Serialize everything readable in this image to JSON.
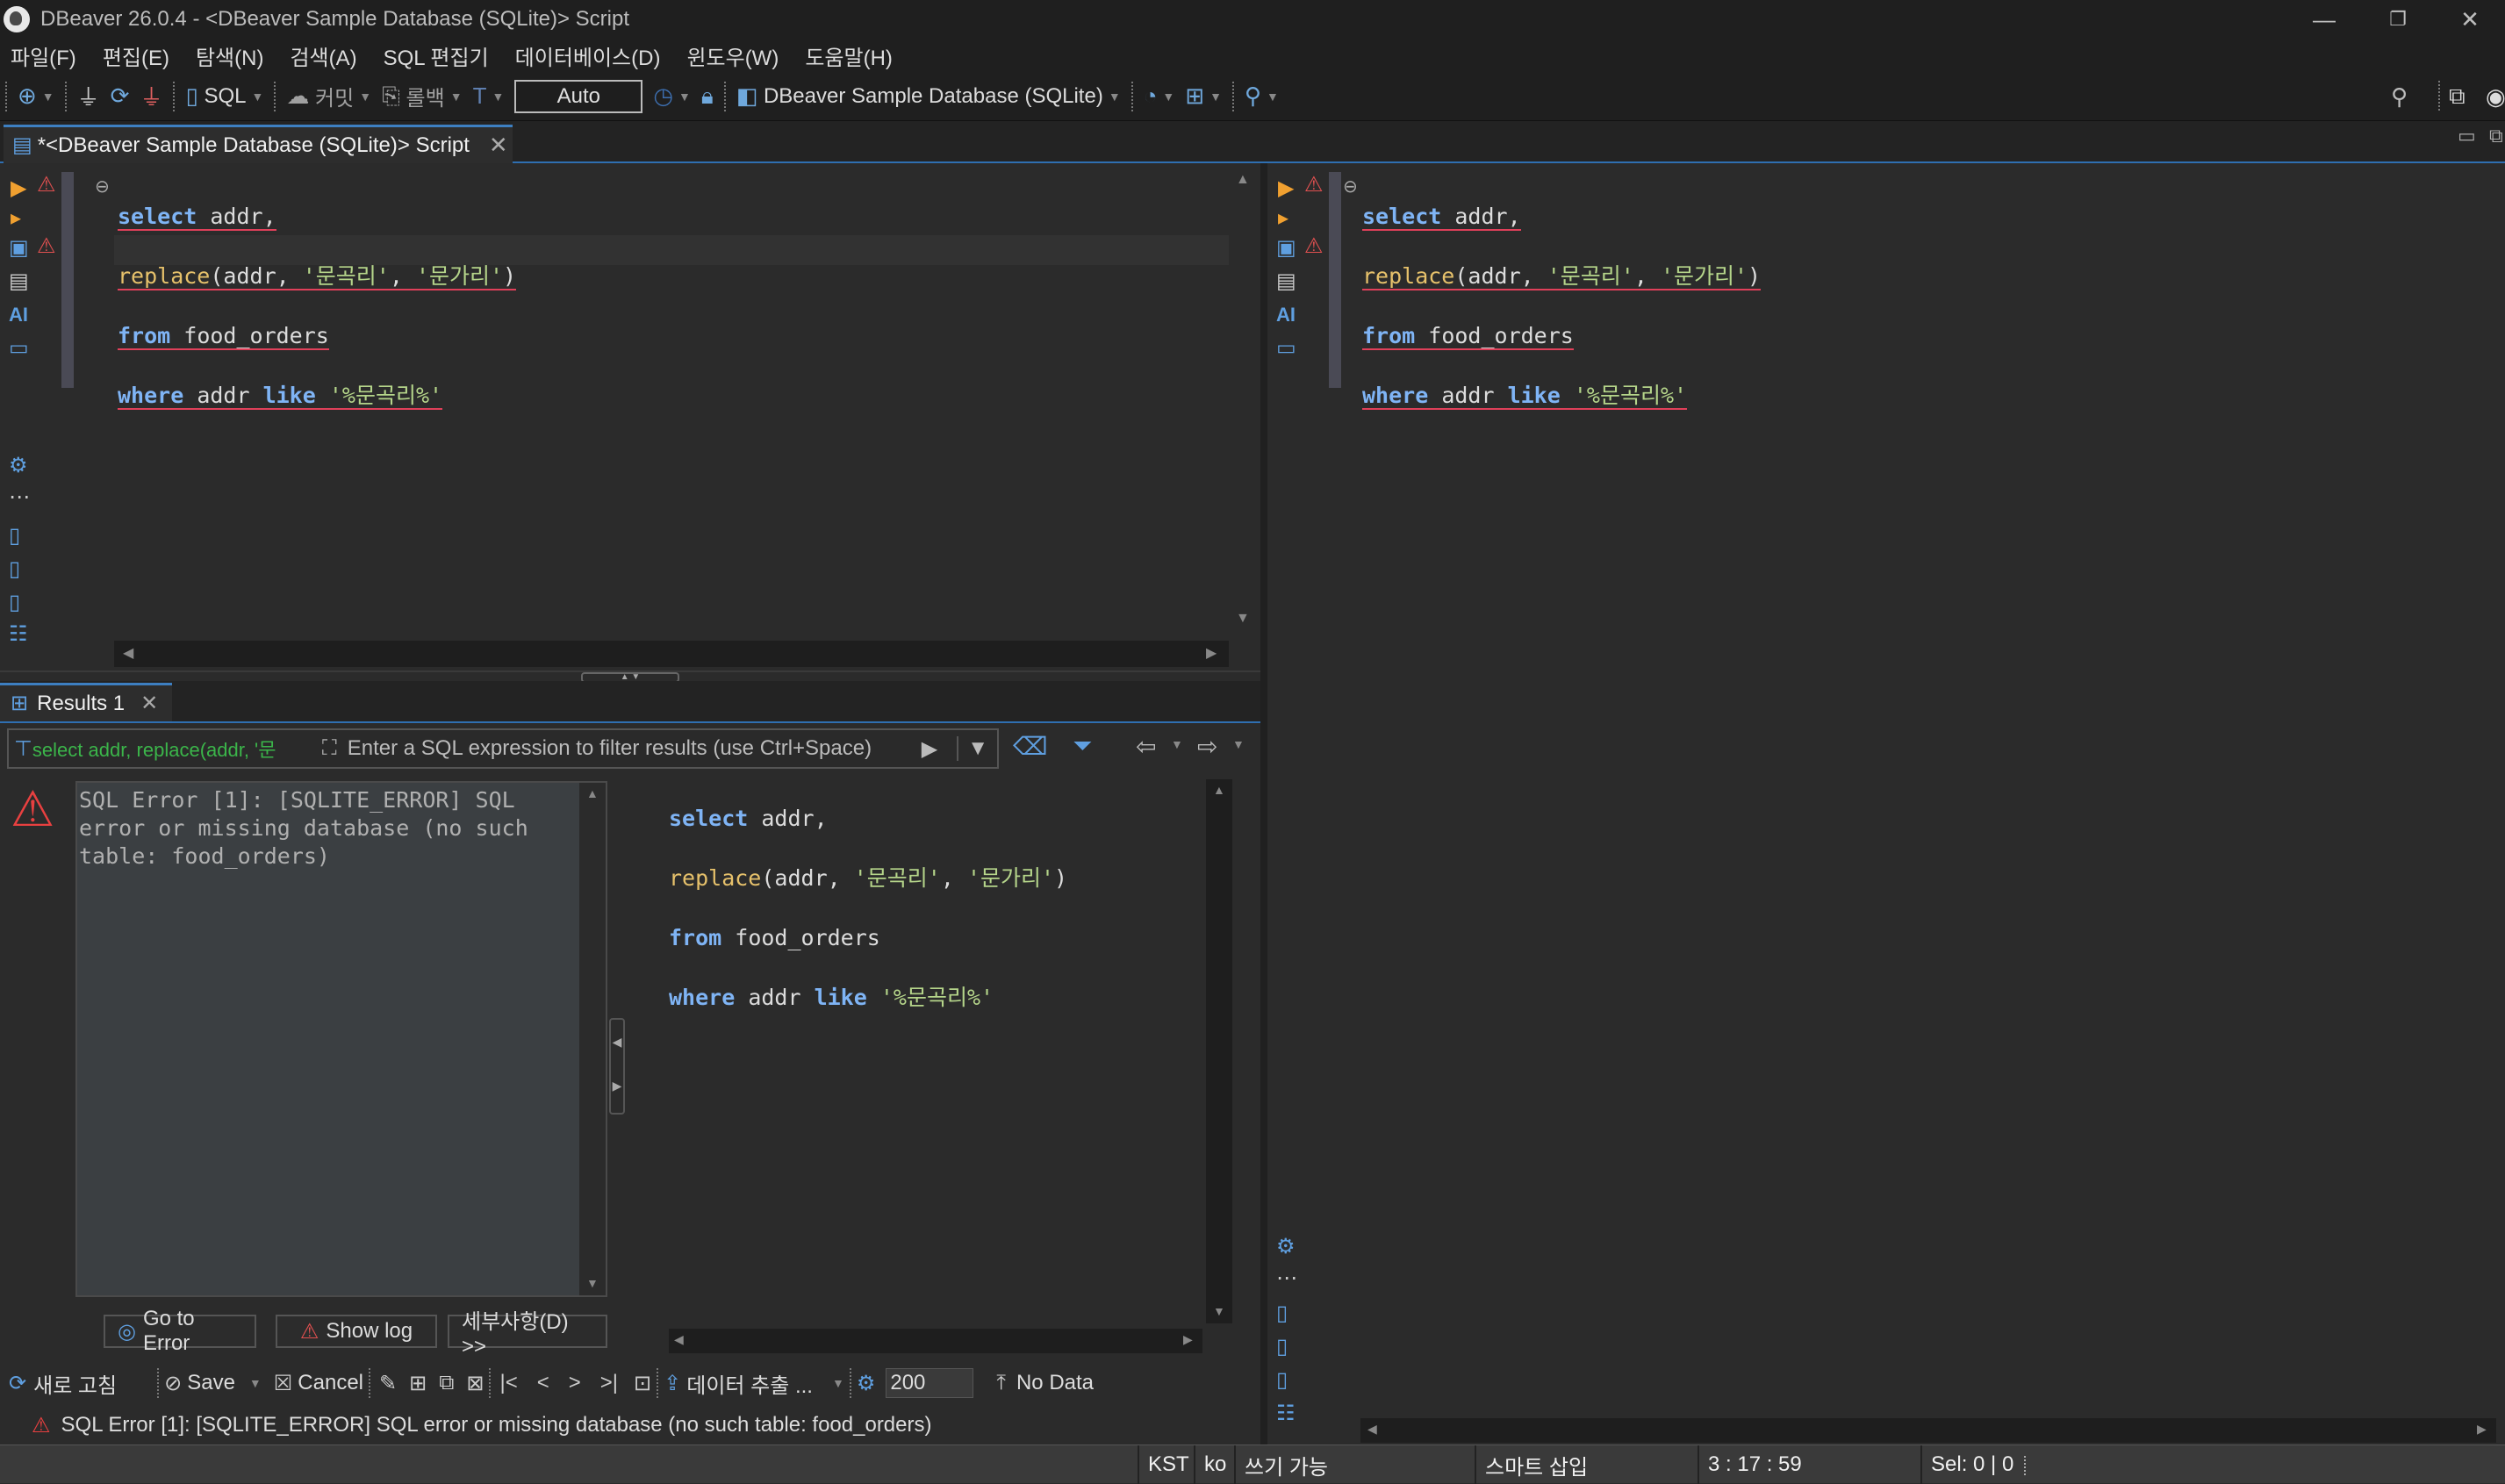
{
  "window": {
    "title": "DBeaver 26.0.4 - <DBeaver Sample Database (SQLite)> Script"
  },
  "menu": [
    "파일(F)",
    "편집(E)",
    "탐색(N)",
    "검색(A)",
    "SQL 편집기",
    "데이터베이스(D)",
    "윈도우(W)",
    "도움말(H)"
  ],
  "toolbar": {
    "sql_label": "SQL",
    "commit_label": "커밋",
    "rollback_label": "롤백",
    "transaction_mode": "Auto",
    "datasource_label": "DBeaver Sample Database (SQLite)"
  },
  "editor_tab": {
    "label": "*<DBeaver Sample Database (SQLite)> Script"
  },
  "sql": {
    "line1_kw": "select",
    "line1_rest": " addr,",
    "line2_fn": "replace",
    "line2_a": "(addr, ",
    "line2_s1": "'문곡리'",
    "line2_b": ", ",
    "line2_s2": "'문가리'",
    "line2_c": ")",
    "line3_kw": "from",
    "line3_rest": " food_orders",
    "line4_kw1": "where",
    "line4_mid": " addr ",
    "line4_kw2": "like",
    "line4_sp": " ",
    "line4_s": "'%문곡리%'"
  },
  "results": {
    "tab_label": "Results 1",
    "filter_query_hint": "select addr, replace(addr, '문",
    "filter_placeholder": "Enter a SQL expression to filter results (use Ctrl+Space)",
    "error_message": "SQL Error [1]: [SQLITE_ERROR] SQL\nerror or missing database (no such\ntable: food_orders)",
    "go_to_error": "Go to Error",
    "show_log": "Show log",
    "details": "세부사항(D) >>",
    "refresh": "새로 고침",
    "save": "Save",
    "cancel": "Cancel",
    "export": "데이터 추출 ...",
    "fetch_size": "200",
    "row_count": "No Data",
    "status_error": "SQL Error [1]: [SQLITE_ERROR] SQL error or missing database (no such table: food_orders)"
  },
  "statusbar": {
    "timezone": "KST",
    "locale": "ko",
    "writable": "쓰기 가능",
    "insert_mode": "스마트 삽입",
    "position": "3 : 17 : 59",
    "selection": "Sel: 0 | 0"
  },
  "colors": {
    "keyword": "#7fb4f5",
    "function": "#e6c16b",
    "string": "#b5d58a",
    "error": "#e0405a",
    "accent": "#3d7fc1"
  }
}
